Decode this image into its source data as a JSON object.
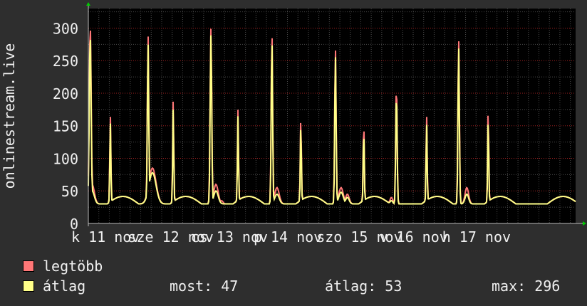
{
  "chart_data": {
    "type": "line",
    "ylabel": "onlinestream.live",
    "ylim": [
      0,
      330
    ],
    "yticks": [
      0,
      50,
      100,
      150,
      200,
      250,
      300
    ],
    "xlim": [
      0,
      7.75
    ],
    "xtick_labels": [
      {
        "x": 0.0,
        "label": "k 11 nov"
      },
      {
        "x": 0.9,
        "label": "sze 12 nov"
      },
      {
        "x": 1.9,
        "label": "cs 13 nov"
      },
      {
        "x": 2.9,
        "label": "p 14 nov"
      },
      {
        "x": 3.9,
        "label": "szo 15 nov"
      },
      {
        "x": 4.9,
        "label": "v 16 nov"
      },
      {
        "x": 5.9,
        "label": "h 17 nov"
      }
    ],
    "grid": true,
    "series": [
      {
        "name": "legtöbb",
        "color": "#ff7777",
        "peaks": [
          [
            0.03,
            305,
            0.022
          ],
          [
            0.06,
            60,
            0.05
          ],
          [
            0.35,
            165,
            0.012
          ],
          [
            0.45,
            25,
            0.08
          ],
          [
            0.95,
            290,
            0.016
          ],
          [
            1.02,
            85,
            0.08
          ],
          [
            1.11,
            40,
            0.03
          ],
          [
            1.35,
            190,
            0.012
          ],
          [
            1.55,
            30,
            0.08
          ],
          [
            1.95,
            300,
            0.018
          ],
          [
            2.03,
            60,
            0.05
          ],
          [
            2.12,
            35,
            0.03
          ],
          [
            2.38,
            175,
            0.012
          ],
          [
            2.6,
            35,
            0.08
          ],
          [
            2.92,
            295,
            0.016
          ],
          [
            3.0,
            55,
            0.05
          ],
          [
            3.12,
            25,
            0.03
          ],
          [
            3.38,
            165,
            0.012
          ],
          [
            3.6,
            22,
            0.08
          ],
          [
            3.93,
            268,
            0.016
          ],
          [
            4.02,
            55,
            0.05
          ],
          [
            4.12,
            45,
            0.04
          ],
          [
            4.38,
            160,
            0.012
          ],
          [
            4.62,
            25,
            0.08
          ],
          [
            4.9,
            215,
            0.016
          ],
          [
            4.82,
            40,
            0.03
          ],
          [
            4.98,
            30,
            0.04
          ],
          [
            5.38,
            167,
            0.012
          ],
          [
            5.6,
            20,
            0.08
          ],
          [
            5.89,
            283,
            0.016
          ],
          [
            6.02,
            55,
            0.04
          ],
          [
            6.12,
            30,
            0.04
          ],
          [
            6.36,
            178,
            0.012
          ],
          [
            6.55,
            20,
            0.08
          ]
        ]
      },
      {
        "name": "átlag",
        "color": "#ffff88",
        "peaks": [
          [
            0.03,
            292,
            0.02
          ],
          [
            0.06,
            50,
            0.05
          ],
          [
            0.35,
            155,
            0.011
          ],
          [
            0.45,
            20,
            0.08
          ],
          [
            0.95,
            278,
            0.015
          ],
          [
            1.02,
            78,
            0.08
          ],
          [
            1.11,
            35,
            0.03
          ],
          [
            1.35,
            178,
            0.011
          ],
          [
            1.55,
            25,
            0.08
          ],
          [
            1.95,
            290,
            0.017
          ],
          [
            2.03,
            50,
            0.05
          ],
          [
            2.12,
            30,
            0.03
          ],
          [
            2.38,
            165,
            0.011
          ],
          [
            2.6,
            30,
            0.08
          ],
          [
            2.92,
            285,
            0.015
          ],
          [
            3.0,
            45,
            0.05
          ],
          [
            3.12,
            22,
            0.03
          ],
          [
            3.38,
            155,
            0.011
          ],
          [
            3.6,
            18,
            0.08
          ],
          [
            3.93,
            258,
            0.015
          ],
          [
            4.02,
            48,
            0.05
          ],
          [
            4.12,
            40,
            0.04
          ],
          [
            4.38,
            150,
            0.011
          ],
          [
            4.62,
            20,
            0.08
          ],
          [
            4.9,
            205,
            0.015
          ],
          [
            4.82,
            35,
            0.03
          ],
          [
            4.98,
            25,
            0.04
          ],
          [
            5.38,
            155,
            0.011
          ],
          [
            5.6,
            17,
            0.08
          ],
          [
            5.89,
            272,
            0.015
          ],
          [
            6.02,
            45,
            0.04
          ],
          [
            6.12,
            25,
            0.04
          ],
          [
            6.36,
            165,
            0.011
          ],
          [
            6.55,
            17,
            0.08
          ]
        ]
      }
    ],
    "baseline_daily": {
      "day_low": 30,
      "night_low": 27,
      "evening_high": 50
    }
  },
  "legend": [
    {
      "label": "legtöbb",
      "color": "#ff7777"
    },
    {
      "label": "átlag",
      "color": "#ffff88"
    }
  ],
  "stats": {
    "now": "most: 47",
    "avg": "átlag: 53",
    "max": "max: 296"
  },
  "colors": {
    "background": "#2e2e2e",
    "plot": "#000000",
    "grid": "#4a4a4a",
    "grid_minor": "#a02020",
    "axis": "#bbbbbb",
    "text": "#f0f0f0",
    "arrow": "#00cc00"
  }
}
